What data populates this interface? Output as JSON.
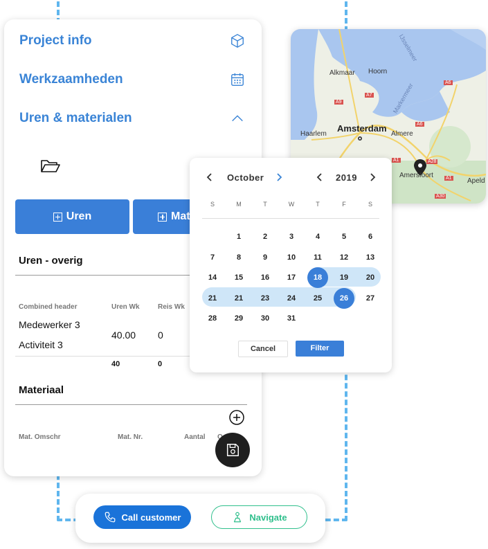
{
  "accordion": {
    "project_info": "Project info",
    "werkzaamheden": "Werkzaamheden",
    "uren_materialen": "Uren & materialen"
  },
  "buttons": {
    "uren": "Uren",
    "materialen": "Mat"
  },
  "uren_overig": {
    "title": "Uren - overig",
    "headers": [
      "Combined header",
      "Uren Wk",
      "Reis Wk"
    ],
    "rows": [
      {
        "medewerker": "Medewerker 3",
        "activiteit": "Activiteit 3",
        "uren": "40.00",
        "reis": "0"
      }
    ],
    "totals": {
      "uren": "40",
      "reis": "0"
    }
  },
  "materiaal": {
    "title": "Materiaal",
    "headers": [
      "Mat. Omschr",
      "Mat. Nr.",
      "Aantal",
      "O"
    ]
  },
  "map": {
    "labels": [
      "IJsselmeer",
      "Alkmaar",
      "Hoorn",
      "Markermeer",
      "Amsterdam",
      "Haarlem",
      "Almere",
      "Amersfoort",
      "Apeld"
    ],
    "roads": [
      "A7",
      "A9",
      "A6",
      "A6",
      "A1",
      "A28",
      "A1",
      "A30"
    ]
  },
  "calendar": {
    "month": "October",
    "year": "2019",
    "weekdays": [
      "S",
      "M",
      "T",
      "W",
      "T",
      "F",
      "S"
    ],
    "weeks": [
      [
        "",
        "1",
        "2",
        "3",
        "4",
        "5",
        "6"
      ],
      [
        "7",
        "8",
        "9",
        "10",
        "11",
        "12",
        "13"
      ],
      [
        "14",
        "15",
        "16",
        "17",
        "18",
        "19",
        "20"
      ],
      [
        "21",
        "21",
        "23",
        "24",
        "25",
        "26",
        "27"
      ],
      [
        "28",
        "29",
        "30",
        "31",
        "",
        "",
        ""
      ]
    ],
    "selected_start": "18",
    "selected_end": "26",
    "cancel_label": "Cancel",
    "filter_label": "Filter"
  },
  "actions": {
    "call": "Call customer",
    "navigate": "Navigate"
  },
  "colors": {
    "accent": "#3a84d6",
    "button": "#3a7fd8",
    "range": "#cfe6f8",
    "navigate": "#2fbf8c",
    "call": "#1a73d9"
  }
}
